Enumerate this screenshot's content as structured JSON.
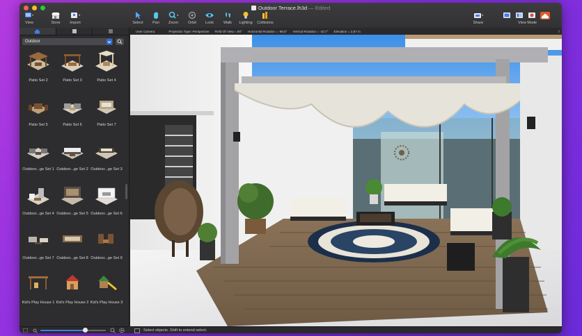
{
  "window": {
    "title": "Outdoor Terrace.lh3d",
    "title_suffix": " — Edited"
  },
  "toolbar": {
    "left": [
      {
        "label": "View",
        "icon": "view-icon"
      },
      {
        "label": "Store",
        "icon": "store-icon"
      },
      {
        "label": "Import",
        "icon": "import-icon"
      }
    ],
    "center": [
      {
        "label": "Select",
        "icon": "select-arrow-icon"
      },
      {
        "label": "Pan",
        "icon": "pan-icon"
      },
      {
        "label": "Zoom",
        "icon": "zoom-icon"
      },
      {
        "label": "Orbit",
        "icon": "orbit-icon"
      },
      {
        "label": "Look",
        "icon": "look-eye-icon"
      },
      {
        "label": "Walk",
        "icon": "walk-icon"
      },
      {
        "label": "Lighting",
        "icon": "lightbulb-icon"
      },
      {
        "label": "Collisions",
        "icon": "collisions-icon"
      }
    ],
    "right": [
      {
        "label": "Share",
        "icon": "share-icon"
      },
      {
        "label": "View Mode",
        "icon": "view-mode-icon"
      }
    ]
  },
  "infobar": {
    "camera": "User Camera",
    "projection": "Projection Type: Perspective",
    "field_of_view": "Field Of View = 60°",
    "horizontal_rotation": "Horizontal Rotation = -98,8°",
    "vertical_rotation": "Vertical Rotation = -10,7°",
    "elevation": "Elevation = 2,87 m"
  },
  "library": {
    "category": "Outdoor",
    "items": [
      {
        "name": "Patio Set 2"
      },
      {
        "name": "Patio Set 3"
      },
      {
        "name": "Patio Set 4"
      },
      {
        "name": "Patio Set 5"
      },
      {
        "name": "Patio Set 6"
      },
      {
        "name": "Patio Set 7"
      },
      {
        "name": "Outdoor...ge Set 1"
      },
      {
        "name": "Outdoor...ge Set 2"
      },
      {
        "name": "Outdoor...ge Set 3"
      },
      {
        "name": "Outdoor...ge Set 4"
      },
      {
        "name": "Outdoor...ge Set 5"
      },
      {
        "name": "Outdoor...ge Set 6"
      },
      {
        "name": "Outdoor...ge Set 7"
      },
      {
        "name": "Outdoor...ge Set 8"
      },
      {
        "name": "Outdoor...ge Set 9"
      },
      {
        "name": "Kid's Play House 1"
      },
      {
        "name": "Kid's Play House 2"
      },
      {
        "name": "Kid's Play House 3"
      }
    ],
    "thumbnail_zoom": 0.68
  },
  "status": {
    "message": "Select objects. Shift to extend select."
  },
  "colors": {
    "accent": "#2f6fe0",
    "lighting": "#f2c230",
    "look": "#58c6f0"
  }
}
